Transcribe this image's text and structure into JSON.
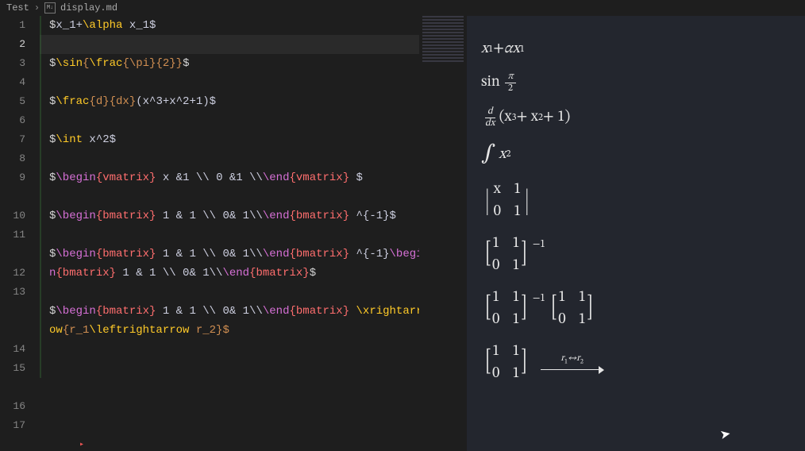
{
  "breadcrumb": {
    "root": "Test",
    "file": "display.md",
    "icon": "M↓"
  },
  "editor": {
    "lines": [
      1,
      2,
      3,
      4,
      5,
      6,
      7,
      8,
      9,
      10,
      11,
      12,
      13,
      14,
      15,
      16,
      17
    ],
    "active_line": 2,
    "rows": {
      "r1": {
        "pre": "$",
        "body": "x_1+",
        "cmd": "\\alpha",
        "rest": " x_1$"
      },
      "r3": {
        "pre": "$",
        "cmd1": "\\sin",
        "brace1": "{",
        "cmd2": "\\frac",
        "args": "{\\pi}{2}",
        "brace2": "}",
        "end": "$"
      },
      "r5": {
        "pre": "$",
        "cmd": "\\frac",
        "args": "{d}{dx}",
        "rest": "(x^3+x^2+1)$"
      },
      "r7": {
        "pre": "$",
        "cmd": "\\int",
        "rest": " x^2$"
      },
      "r9": {
        "pre": "$",
        "begin": "\\begin",
        "benv": "{vmatrix}",
        "body": " x &1 \\\\ 0 &1 \\\\",
        "end": "\\end",
        "eenv": "{vmatrix}",
        "tail": " $"
      },
      "r11": {
        "pre": "$",
        "begin": "\\begin",
        "benv": "{bmatrix}",
        "body": " 1 & 1 \\\\ 0& 1\\\\",
        "end": "\\end",
        "eenv": "{bmatrix}",
        "tail": " ^{-1}$"
      },
      "r13": {
        "pre": "$",
        "begin1": "\\begin",
        "benv1": "{bmatrix}",
        "body1": " 1 & 1 \\\\ 0& 1\\\\",
        "end1": "\\end",
        "eenv1": "{bmatrix}",
        "mid": " ^{-1}",
        "begin2": "\\begin",
        "benv2": "{bmatrix}",
        "body2": " 1 & 1 \\\\ 0& 1\\\\",
        "end2": "\\end",
        "eenv2": "{bmatrix}",
        "tail": "$"
      },
      "r15": {
        "pre": "$",
        "begin": "\\begin",
        "benv": "{bmatrix}",
        "body": " 1 & 1 \\\\ 0& 1\\\\",
        "end": "\\end",
        "eenv": "{bmatrix}",
        "cmd": " \\xrightarrow",
        "args": "{r_1",
        "cmd2": "\\leftrightarrow",
        "args2": " r_2}$"
      }
    }
  },
  "preview": {
    "line1": {
      "x": "x",
      "sub1": "1",
      "plus": " + ",
      "alpha": "α",
      "x2": "x",
      "sub2": "1"
    },
    "line2": {
      "sin": "sin",
      "pi": "π",
      "two": "2"
    },
    "line3": {
      "d": "d",
      "dx": "dx",
      "body": "(x",
      "p3": "3",
      "plus": " + x",
      "p2": "2",
      "rest": " + 1)"
    },
    "line4": {
      "int": "∫",
      "x": "x",
      "p": "2"
    },
    "vmatrix": {
      "a": "x",
      "b": "1",
      "c": "0",
      "d": "1"
    },
    "bmatrix": {
      "a": "1",
      "b": "1",
      "c": "0",
      "d": "1",
      "sup": "−1"
    },
    "bmatrix_pair": {
      "sup": "−1"
    },
    "arrow": {
      "r1": "r",
      "s1": "1",
      "sym": "↔",
      "r2": "r",
      "s2": "2"
    }
  }
}
